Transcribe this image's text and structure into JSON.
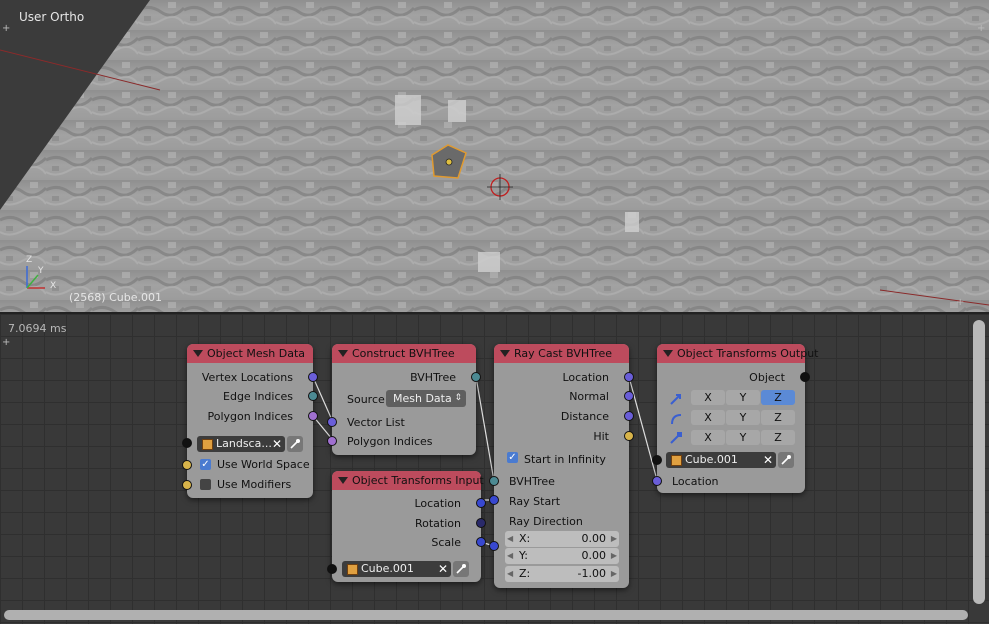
{
  "viewport": {
    "title": "User Ortho",
    "object_info": "(2568) Cube.001",
    "axis_labels": {
      "x": "X",
      "y": "Y",
      "z": "Z"
    }
  },
  "node_editor": {
    "timing": "7.0694 ms",
    "nodes": {
      "object_mesh_data": {
        "title": "Object Mesh Data",
        "outputs": [
          "Vertex Locations",
          "Edge Indices",
          "Polygon Indices"
        ],
        "object_field": "Landsca...",
        "use_world_space_label": "Use World Space",
        "use_world_space": true,
        "use_modifiers_label": "Use Modifiers",
        "use_modifiers": false
      },
      "construct_bvhtree": {
        "title": "Construct BVHTree",
        "output": "BVHTree",
        "source_label": "Source",
        "source_value": "Mesh Data",
        "inputs": [
          "Vector List",
          "Polygon Indices"
        ]
      },
      "object_transforms_input": {
        "title": "Object Transforms Input",
        "outputs": [
          "Location",
          "Rotation",
          "Scale"
        ],
        "object_field": "Cube.001"
      },
      "ray_cast_bvhtree": {
        "title": "Ray Cast BVHTree",
        "outputs": [
          "Location",
          "Normal",
          "Distance",
          "Hit"
        ],
        "start_in_infinity_label": "Start in Infinity",
        "start_in_infinity": true,
        "inputs": [
          "BVHTree",
          "Ray Start",
          "Ray Direction"
        ],
        "direction": [
          {
            "label": "X:",
            "value": "0.00"
          },
          {
            "label": "Y:",
            "value": "0.00"
          },
          {
            "label": "Z:",
            "value": "-1.00"
          }
        ]
      },
      "object_transforms_output": {
        "title": "Object Transforms Output",
        "output": "Object",
        "axes": [
          "X",
          "Y",
          "Z"
        ],
        "selected_first_row": "Z",
        "object_field": "Cube.001",
        "input": "Location"
      }
    }
  }
}
